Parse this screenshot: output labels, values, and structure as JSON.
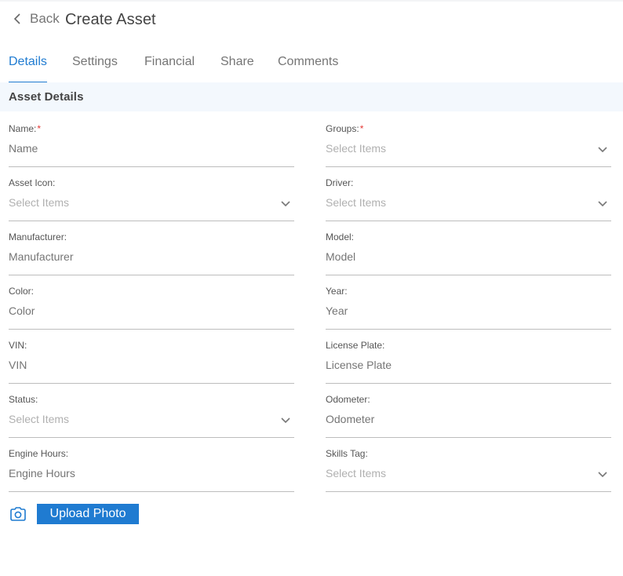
{
  "header": {
    "back_label": "Back",
    "title": "Create Asset"
  },
  "tabs": [
    {
      "label": "Details",
      "active": true
    },
    {
      "label": "Settings",
      "active": false
    },
    {
      "label": "Financial",
      "active": false
    },
    {
      "label": "Share",
      "active": false
    },
    {
      "label": "Comments",
      "active": false
    }
  ],
  "section": {
    "title": "Asset Details"
  },
  "fields": {
    "name": {
      "label": "Name:",
      "required": "*",
      "placeholder": "Name"
    },
    "groups": {
      "label": "Groups:",
      "required": "*",
      "placeholder": "Select Items"
    },
    "asset_icon": {
      "label": "Asset Icon:",
      "placeholder": "Select Items"
    },
    "driver": {
      "label": "Driver:",
      "placeholder": "Select Items"
    },
    "manufacturer": {
      "label": "Manufacturer:",
      "placeholder": "Manufacturer"
    },
    "model": {
      "label": "Model:",
      "placeholder": "Model"
    },
    "color": {
      "label": "Color:",
      "placeholder": "Color"
    },
    "year": {
      "label": "Year:",
      "placeholder": "Year"
    },
    "vin": {
      "label": "VIN:",
      "placeholder": "VIN"
    },
    "license_plate": {
      "label": "License Plate:",
      "placeholder": "License Plate"
    },
    "status": {
      "label": "Status:",
      "placeholder": "Select Items"
    },
    "odometer": {
      "label": "Odometer:",
      "placeholder": "Odometer"
    },
    "engine_hours": {
      "label": "Engine Hours:",
      "placeholder": "Engine Hours"
    },
    "skills_tag": {
      "label": "Skills Tag:",
      "placeholder": "Select Items"
    }
  },
  "upload": {
    "label": "Upload Photo",
    "icon": "camera-icon"
  },
  "colors": {
    "accent": "#1f7bd1",
    "required": "#e53935",
    "section_bg": "#f3f8fd"
  }
}
